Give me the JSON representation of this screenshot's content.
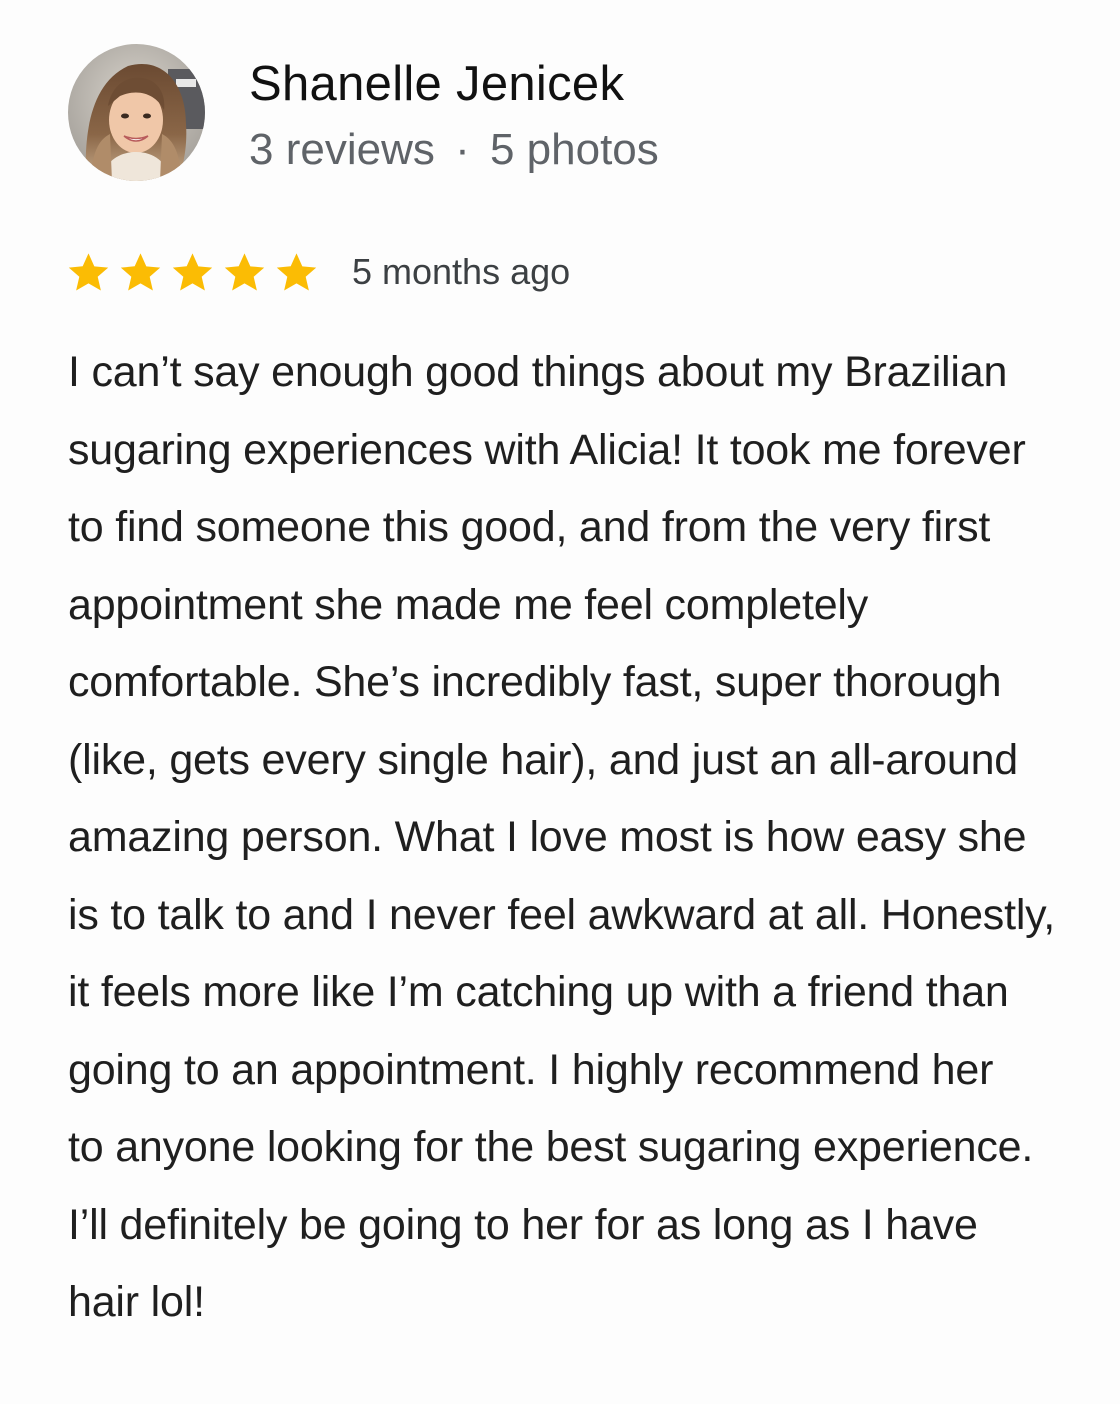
{
  "reviewer": {
    "name": "Shanelle Jenicek",
    "reviews": "3 reviews",
    "separator": "·",
    "photos": "5 photos"
  },
  "rating": {
    "stars": 5,
    "max_stars": 5,
    "star_color": "#fbbc04",
    "icon": "star-icon",
    "time_ago": "5 months ago"
  },
  "review": {
    "lines": [
      "I can’t say enough good things about my Brazilian",
      "sugaring experiences with Alicia! It took me forever",
      "to find someone this good, and from the very first",
      "appointment she made me feel completely",
      "comfortable. She’s incredibly fast, super thorough",
      "(like, gets every single hair), and just an all-around",
      "amazing person. What I love most is how easy she",
      "is to talk to and I never feel awkward at all. Honestly,",
      "it feels more like I’m catching up with a friend than",
      "going to an appointment. I highly recommend her",
      "to anyone looking for the best sugaring experience.",
      "I’ll definitely be going to her for as long as I have",
      "hair lol!"
    ]
  }
}
